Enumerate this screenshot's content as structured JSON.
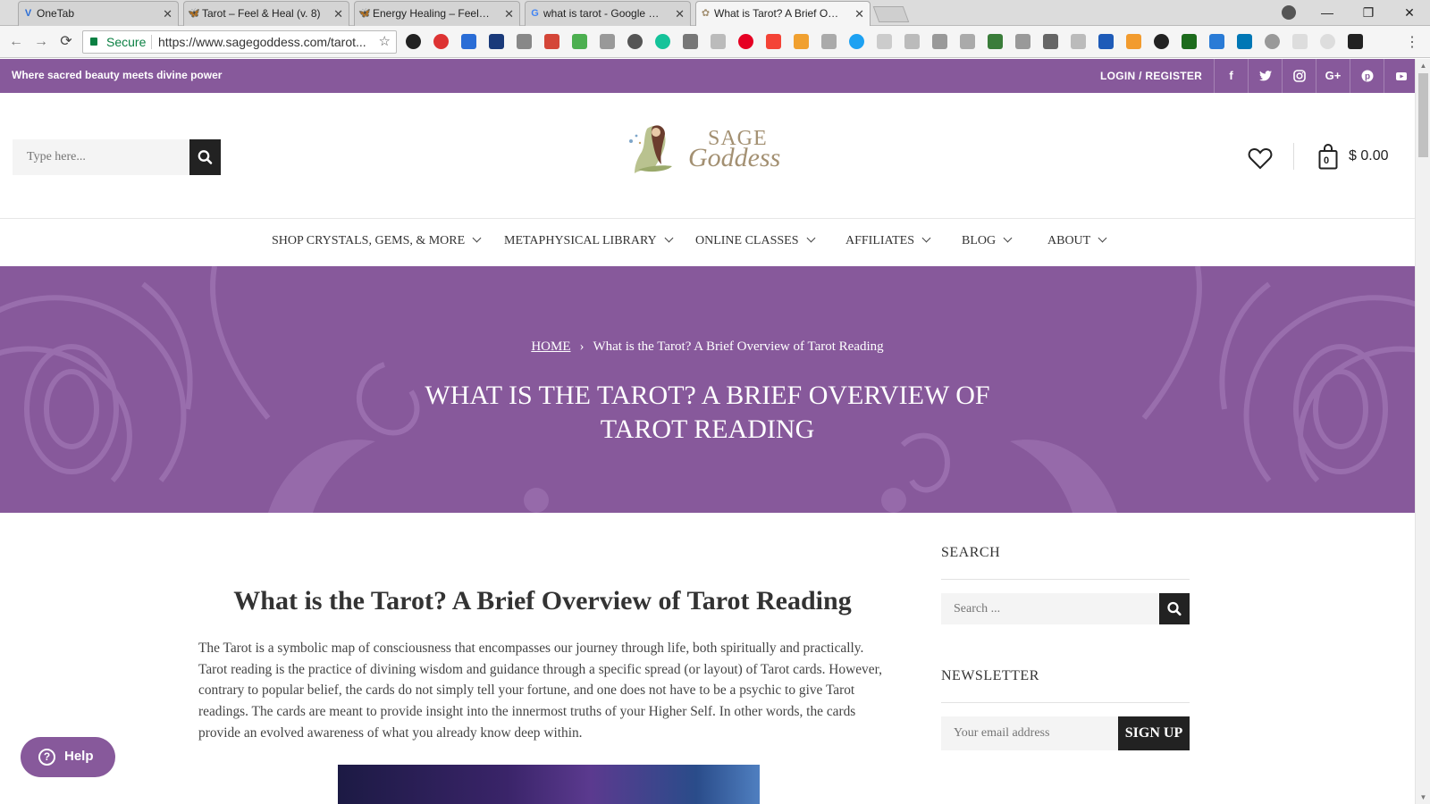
{
  "browser": {
    "tabs": [
      {
        "title": "OneTab",
        "favicon": "onetab-icon"
      },
      {
        "title": "Tarot – Feel & Heal (v. 8)",
        "favicon": "butterfly-icon"
      },
      {
        "title": "Energy Healing – Feel & Heal",
        "favicon": "butterfly-icon"
      },
      {
        "title": "what is tarot - Google Search",
        "favicon": "google-icon"
      },
      {
        "title": "What is Tarot? A Brief Overview",
        "favicon": "sage-goddess-icon"
      }
    ],
    "secure_label": "Secure",
    "url": "https://www.sagegoddess.com/tarot..."
  },
  "topbar": {
    "tagline": "Where sacred beauty meets divine power",
    "login": "LOGIN / REGISTER",
    "social": [
      "f",
      "t",
      "ig",
      "G+",
      "p",
      "yt"
    ]
  },
  "header": {
    "search_placeholder": "Type here...",
    "logo_line1": "SAGE",
    "logo_line2": "Goddess",
    "cart_count": "0",
    "cart_total": "$ 0.00"
  },
  "menu": [
    {
      "label": "SHOP CRYSTALS, GEMS, & MORE"
    },
    {
      "label": "METAPHYSICAL LIBRARY"
    },
    {
      "label": "ONLINE CLASSES"
    },
    {
      "label": "AFFILIATES"
    },
    {
      "label": "BLOG"
    },
    {
      "label": "ABOUT"
    }
  ],
  "hero": {
    "breadcrumb_home": "HOME",
    "breadcrumb_current": "What is the Tarot? A Brief Overview of Tarot Reading",
    "title": "WHAT IS THE TAROT? A BRIEF OVERVIEW OF TAROT READING"
  },
  "article": {
    "title": "What is the Tarot? A Brief Overview of Tarot Reading",
    "body": "The Tarot is a symbolic map of consciousness that encompasses our journey through life, both spiritually and practically. Tarot reading is the practice of divining wisdom and guidance through a specific spread (or layout) of Tarot cards. However, contrary to popular belief, the cards do not simply tell your fortune, and one does not have to be a psychic to give Tarot readings. The cards are meant to provide insight into the innermost truths of your Higher Self. In other words, the cards provide an evolved awareness of what you already know deep within."
  },
  "sidebar": {
    "search_heading": "SEARCH",
    "search_placeholder": "Search ...",
    "newsletter_heading": "NEWSLETTER",
    "email_placeholder": "Your email address",
    "signup_label": "SIGN UP"
  },
  "help": {
    "label": "Help"
  },
  "colors": {
    "brand_purple": "#87599b",
    "dark": "#222222"
  }
}
